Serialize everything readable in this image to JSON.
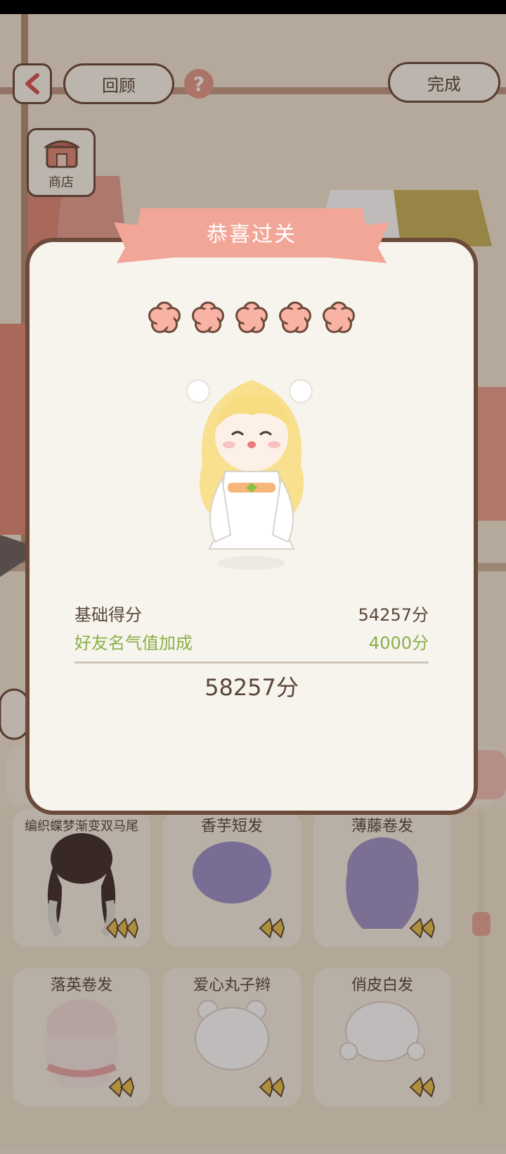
{
  "header": {
    "back_icon": "chevron-left-icon",
    "review_label": "回顾",
    "help_icon": "question-icon",
    "help_glyph": "?",
    "done_label": "完成"
  },
  "shop": {
    "label": "商店",
    "icon": "shop-icon"
  },
  "modal": {
    "title": "恭喜过关",
    "stars_filled": 5,
    "stars_total": 5,
    "base_score_label": "基础得分",
    "base_score_value": "54257分",
    "bonus_label": "好友名气值加成",
    "bonus_value": "4000分",
    "total_value": "58257分"
  },
  "hair_items": [
    {
      "name": "编织蝶梦渐变双马尾",
      "hair_color": "#3f2e2c"
    },
    {
      "name": "香芋短发",
      "hair_color": "#9b90c9"
    },
    {
      "name": "薄藤卷发",
      "hair_color": "#a093c8"
    },
    {
      "name": "落英卷发",
      "hair_color": "#f3ddd9"
    },
    {
      "name": "爱心丸子辫",
      "hair_color": "#ffffff"
    },
    {
      "name": "俏皮白发",
      "hair_color": "#ffffff"
    }
  ],
  "colors": {
    "accent": "#f2a698",
    "border": "#6b4a3a",
    "bonus_green": "#8bb04a",
    "star_fill": "#f8b3a5",
    "badge_gold": "#e8c14a"
  }
}
